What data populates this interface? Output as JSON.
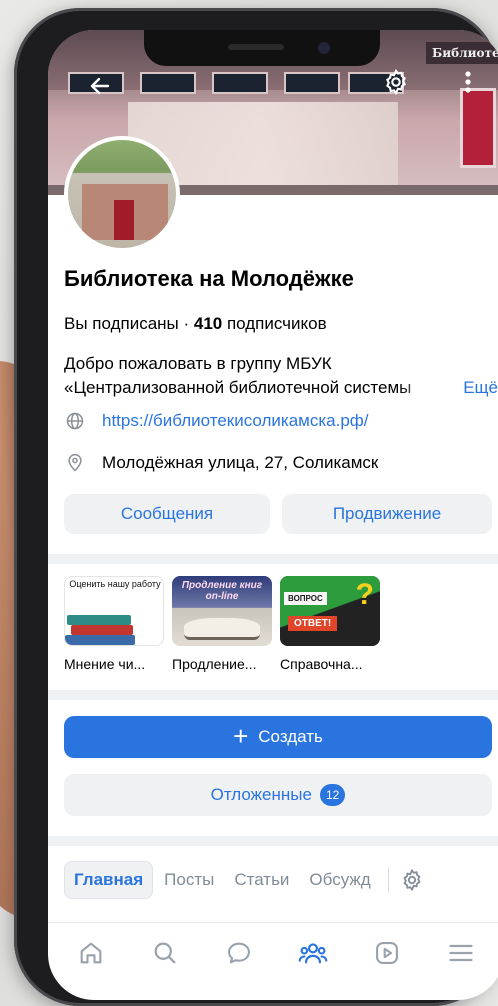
{
  "cover": {
    "sign_text": "Библиотека"
  },
  "group": {
    "name": "Библиотека на Молодёжке",
    "subscribed_text": "Вы подписаны · ",
    "subscribers_count": "410",
    "subscribers_label": " подписчиков",
    "description_line1": "Добро пожаловать в группу МБУК",
    "description_line2": "«Централизованной библиотечной системы",
    "more_label": "Ещё",
    "website": "https://библиотекисоликамска.рф/",
    "address": "Молодёжная улица, 27, Соликамск"
  },
  "actions": {
    "messages_label": "Сообщения",
    "promotion_label": "Продвижение"
  },
  "services": [
    {
      "caption": "Мнение чи...",
      "thumb_text": "Оценить нашу работу"
    },
    {
      "caption": "Продление...",
      "thumb_text": "Продление книг on-line"
    },
    {
      "caption": "Справочна...",
      "thumb_text_1": "ВОПРОС",
      "thumb_text_2": "ОТВЕТ!",
      "thumb_text_3": "?"
    }
  ],
  "create": {
    "label": "Создать",
    "plus": "+"
  },
  "postponed": {
    "label": "Отложенные",
    "count": "12"
  },
  "tabs": [
    "Главная",
    "Посты",
    "Статьи",
    "Обсужд"
  ],
  "bottom_nav": [
    "home-icon",
    "search-icon",
    "messages-icon",
    "community-icon",
    "video-icon",
    "menu-icon"
  ],
  "colors": {
    "accent": "#2a74e0",
    "secondary_text": "#818c99",
    "chip_bg": "#f0f1f3"
  }
}
